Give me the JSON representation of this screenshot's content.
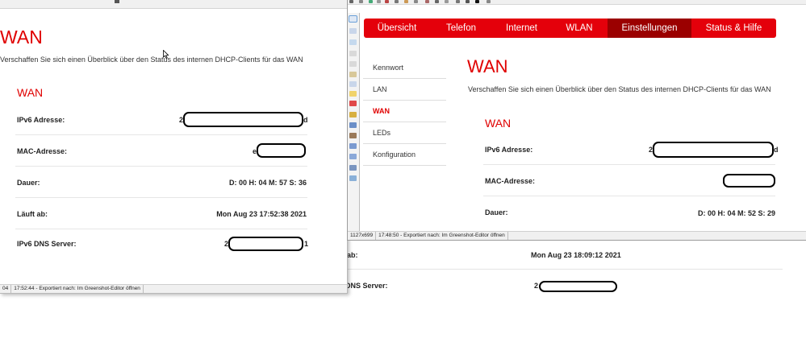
{
  "background_page": {
    "rows": [
      {
        "label": "ab:",
        "value": "Mon Aug 23 18:09:12 2021"
      },
      {
        "label": "DNS Server:",
        "value": "2"
      }
    ]
  },
  "left_window": {
    "title": "WAN",
    "description": "Verschaffen Sie sich einen Überblick über den Status des internen DHCP-Clients für das WAN",
    "section_title": "WAN",
    "rows": [
      {
        "label": "IPv6 Adresse:",
        "value_prefix": "2",
        "value_suffix": "d",
        "redacted": true
      },
      {
        "label": "MAC-Adresse:",
        "value_prefix": "e",
        "value_suffix": "",
        "redacted": true
      },
      {
        "label": "Dauer:",
        "value": "D: 00 H: 04 M: 57 S: 36"
      },
      {
        "label": "Läuft ab:",
        "value": "Mon Aug 23 17:52:38 2021"
      },
      {
        "label": "IPv6 DNS Server:",
        "value_prefix": "2",
        "value_suffix": "1",
        "redacted": true
      }
    ],
    "statusbar": {
      "segments": [
        "04",
        "17:52:44 - Exportiert nach: Im Greenshot-Editor öffnen"
      ]
    }
  },
  "right_window": {
    "nav_tabs": [
      {
        "label": "Übersicht",
        "active": false
      },
      {
        "label": "Telefon",
        "active": false
      },
      {
        "label": "Internet",
        "active": false
      },
      {
        "label": "WLAN",
        "active": false
      },
      {
        "label": "Einstellungen",
        "active": true
      },
      {
        "label": "Status & Hilfe",
        "active": false
      }
    ],
    "side_menu": [
      {
        "label": "Kennwort",
        "active": false
      },
      {
        "label": "LAN",
        "active": false
      },
      {
        "label": "WAN",
        "active": true
      },
      {
        "label": "LEDs",
        "active": false
      },
      {
        "label": "Konfiguration",
        "active": false
      }
    ],
    "title": "WAN",
    "description": "Verschaffen Sie sich einen Überblick über den Status des internen DHCP-Clients für das WAN",
    "section_title": "WAN",
    "rows": [
      {
        "label": "IPv6 Adresse:",
        "value_prefix": "2",
        "value_suffix": "d",
        "redacted": true
      },
      {
        "label": "MAC-Adresse:",
        "redacted": true
      },
      {
        "label": "Dauer:",
        "value": "D: 00 H: 04 M: 52 S: 29"
      }
    ],
    "statusbar": {
      "segments": [
        "1127x699",
        "17:48:50 - Exportiert nach: Im Greenshot-Editor öffnen"
      ]
    }
  },
  "colors": {
    "brand_red": "#e4000b",
    "active_tab": "#9b0000",
    "heading_red": "#e00000"
  }
}
